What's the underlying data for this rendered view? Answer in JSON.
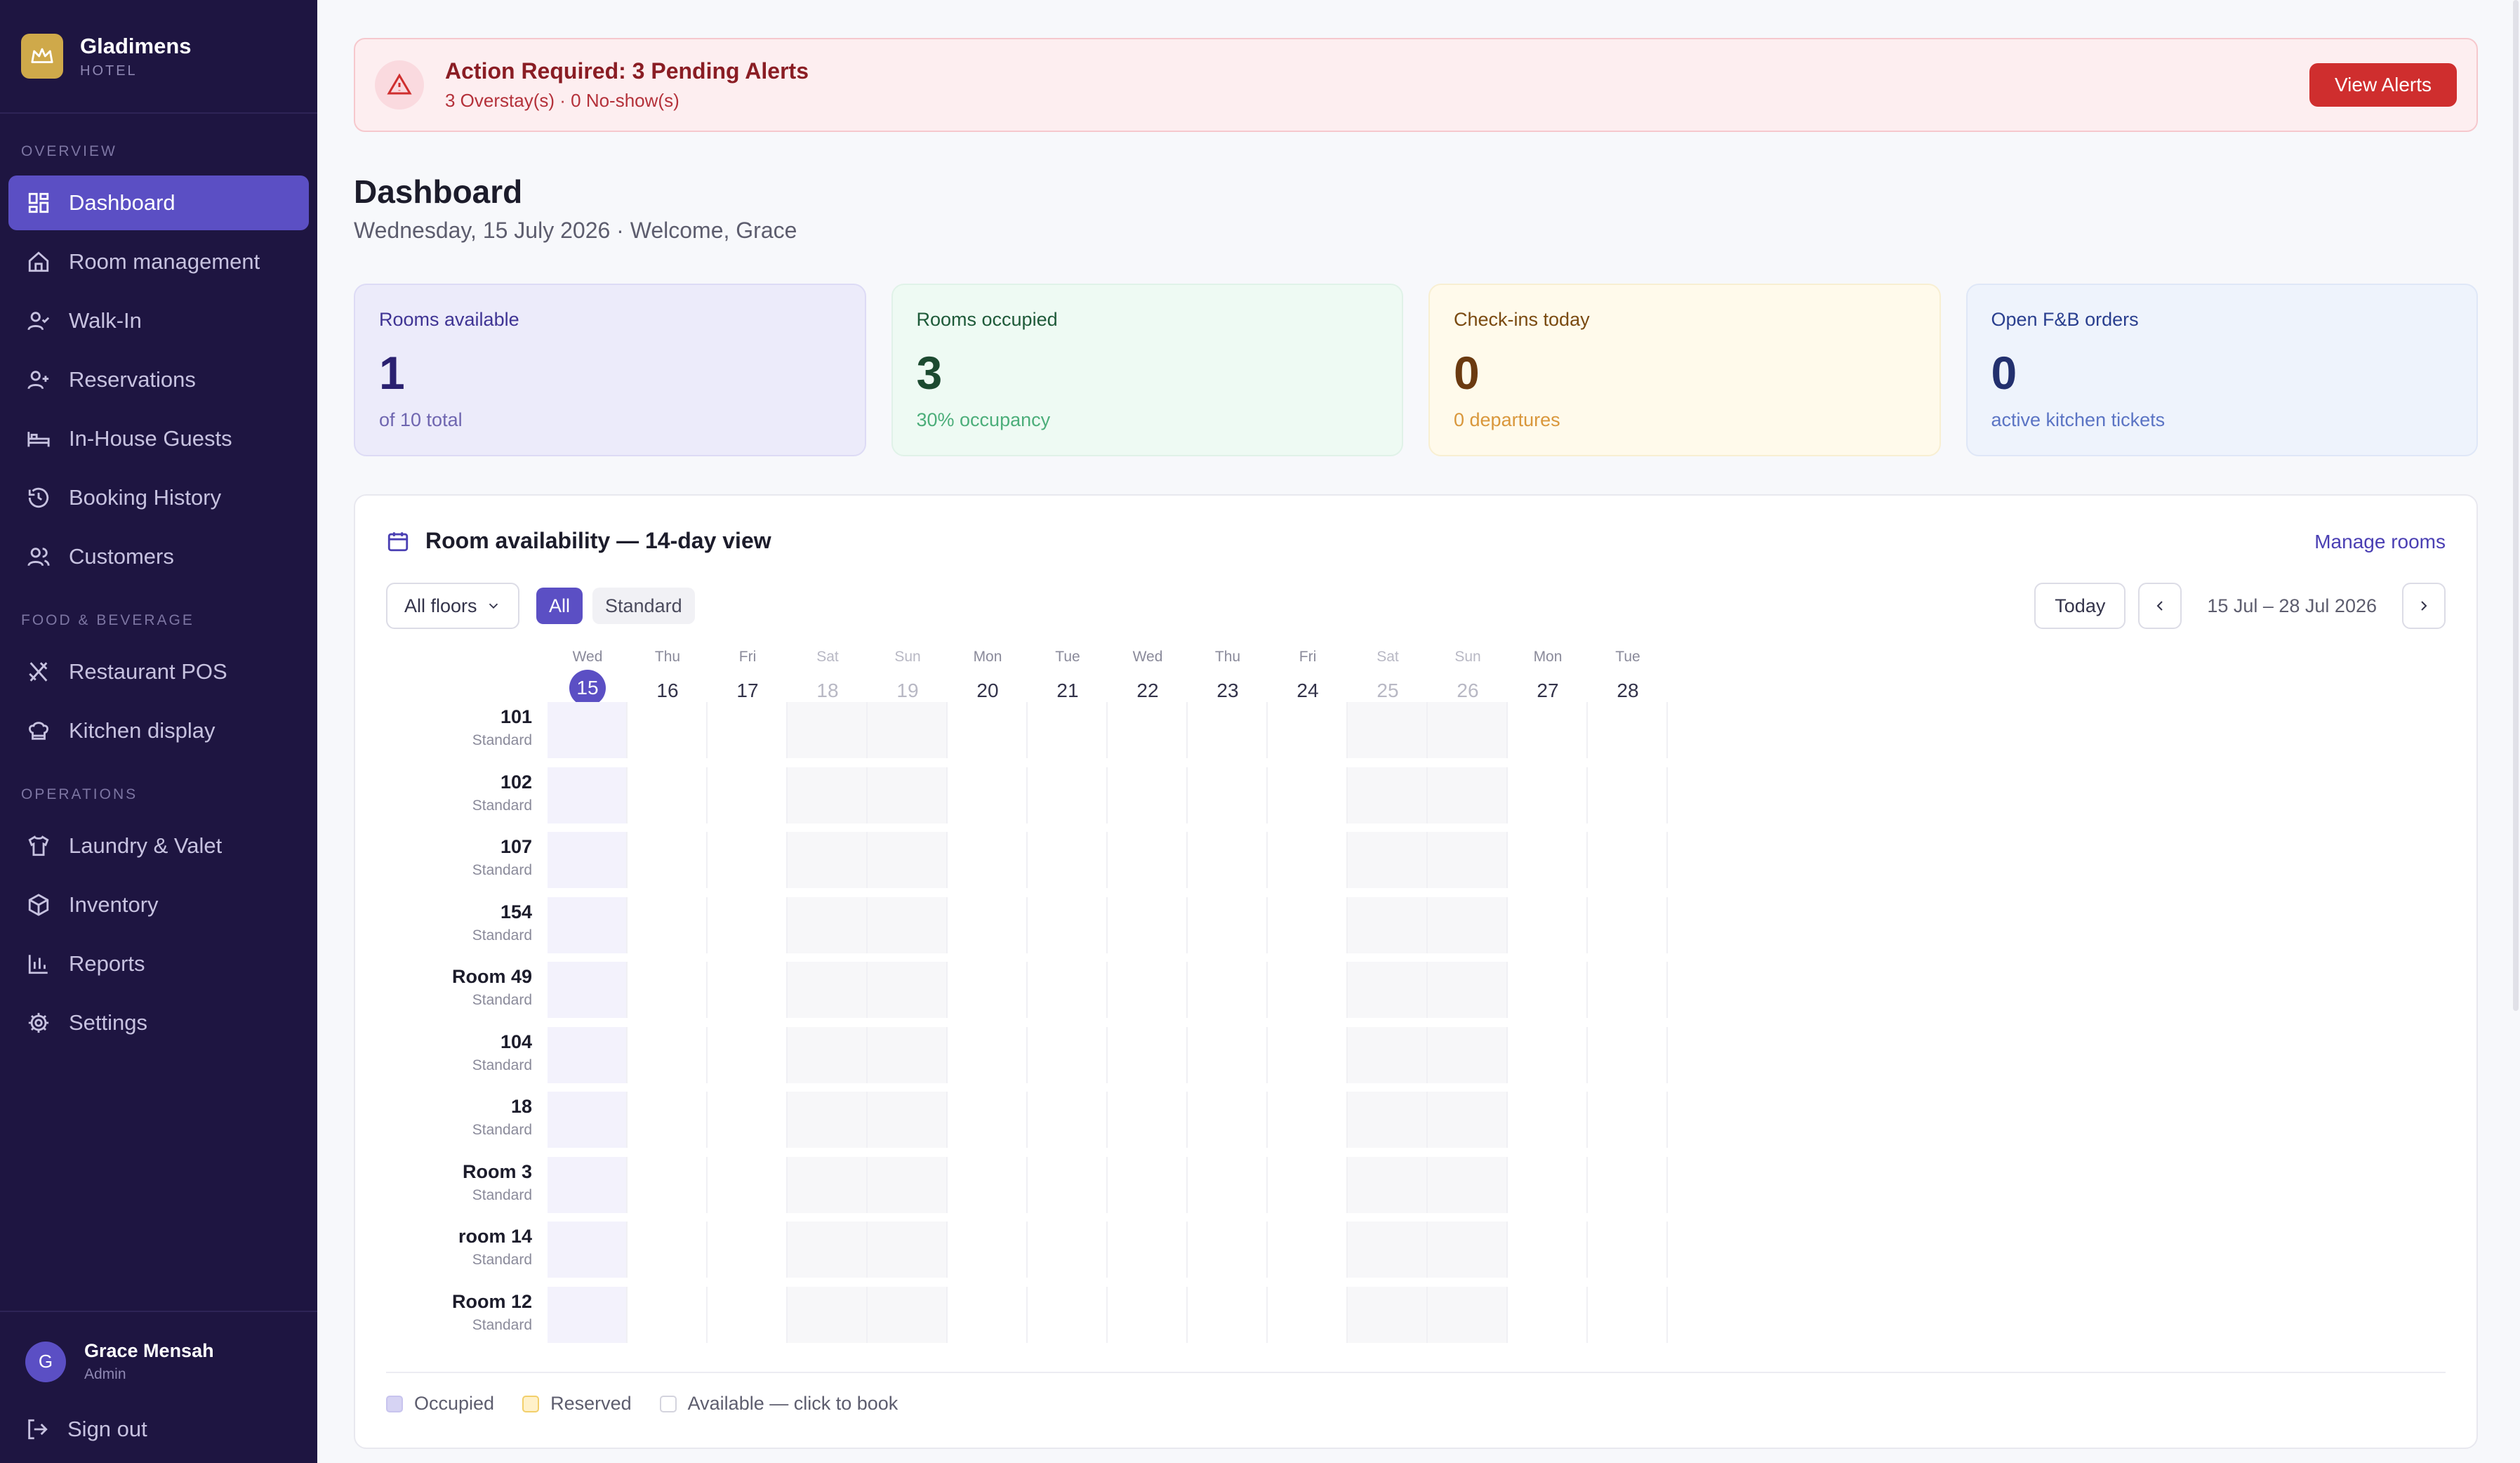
{
  "brand": {
    "name": "Gladimens",
    "sub": "HOTEL"
  },
  "nav": {
    "overview_label": "OVERVIEW",
    "fnb_label": "FOOD & BEVERAGE",
    "operations_label": "OPERATIONS",
    "overview": [
      {
        "label": "Dashboard",
        "icon": "dashboard-icon",
        "active": true
      },
      {
        "label": "Room management",
        "icon": "home-icon"
      },
      {
        "label": "Walk-In",
        "icon": "user-check-icon"
      },
      {
        "label": "Reservations",
        "icon": "user-plus-icon"
      },
      {
        "label": "In-House Guests",
        "icon": "bed-icon"
      },
      {
        "label": "Booking History",
        "icon": "history-icon"
      },
      {
        "label": "Customers",
        "icon": "users-icon"
      }
    ],
    "fnb": [
      {
        "label": "Restaurant POS",
        "icon": "utensils-icon"
      },
      {
        "label": "Kitchen display",
        "icon": "chef-hat-icon"
      }
    ],
    "operations": [
      {
        "label": "Laundry & Valet",
        "icon": "shirt-icon"
      },
      {
        "label": "Inventory",
        "icon": "package-icon"
      },
      {
        "label": "Reports",
        "icon": "bar-chart-icon"
      },
      {
        "label": "Settings",
        "icon": "gear-icon"
      }
    ]
  },
  "user": {
    "initial": "G",
    "name": "Grace Mensah",
    "role": "Admin",
    "signout": "Sign out"
  },
  "alert": {
    "title": "Action Required: 3 Pending Alerts",
    "sub": "3 Overstay(s) · 0 No-show(s)",
    "button": "View Alerts"
  },
  "page": {
    "title": "Dashboard",
    "sub": "Wednesday, 15 July 2026 · Welcome, Grace"
  },
  "stats": [
    {
      "label": "Rooms available",
      "value": "1",
      "note": "of 10 total"
    },
    {
      "label": "Rooms occupied",
      "value": "3",
      "note": "30% occupancy"
    },
    {
      "label": "Check-ins today",
      "value": "0",
      "note": "0 departures"
    },
    {
      "label": "Open F&B orders",
      "value": "0",
      "note": "active kitchen tickets"
    }
  ],
  "availability": {
    "title": "Room availability — 14-day view",
    "manage": "Manage rooms",
    "floor_select": "All floors",
    "filters": [
      "All",
      "Standard"
    ],
    "today_btn": "Today",
    "range": "15 Jul – 28 Jul 2026",
    "days": [
      {
        "dow": "Wed",
        "num": "15",
        "today": true
      },
      {
        "dow": "Thu",
        "num": "16"
      },
      {
        "dow": "Fri",
        "num": "17"
      },
      {
        "dow": "Sat",
        "num": "18",
        "weekend": true
      },
      {
        "dow": "Sun",
        "num": "19",
        "weekend": true
      },
      {
        "dow": "Mon",
        "num": "20"
      },
      {
        "dow": "Tue",
        "num": "21"
      },
      {
        "dow": "Wed",
        "num": "22"
      },
      {
        "dow": "Thu",
        "num": "23"
      },
      {
        "dow": "Fri",
        "num": "24"
      },
      {
        "dow": "Sat",
        "num": "25",
        "weekend": true
      },
      {
        "dow": "Sun",
        "num": "26",
        "weekend": true
      },
      {
        "dow": "Mon",
        "num": "27"
      },
      {
        "dow": "Tue",
        "num": "28"
      }
    ],
    "rooms": [
      {
        "name": "101",
        "type": "Standard"
      },
      {
        "name": "102",
        "type": "Standard"
      },
      {
        "name": "107",
        "type": "Standard"
      },
      {
        "name": "154",
        "type": "Standard"
      },
      {
        "name": "Room 49",
        "type": "Standard"
      },
      {
        "name": "104",
        "type": "Standard"
      },
      {
        "name": "18",
        "type": "Standard"
      },
      {
        "name": "Room 3",
        "type": "Standard"
      },
      {
        "name": "room 14",
        "type": "Standard"
      },
      {
        "name": "Room 12",
        "type": "Standard"
      }
    ],
    "legend": [
      "Occupied",
      "Reserved",
      "Available — click to book"
    ]
  },
  "colors": {
    "sidebar": "#1e1541",
    "accent": "#5b4fc4",
    "alert": "#cf2e2e",
    "brand_logo": "#cfa94a"
  }
}
